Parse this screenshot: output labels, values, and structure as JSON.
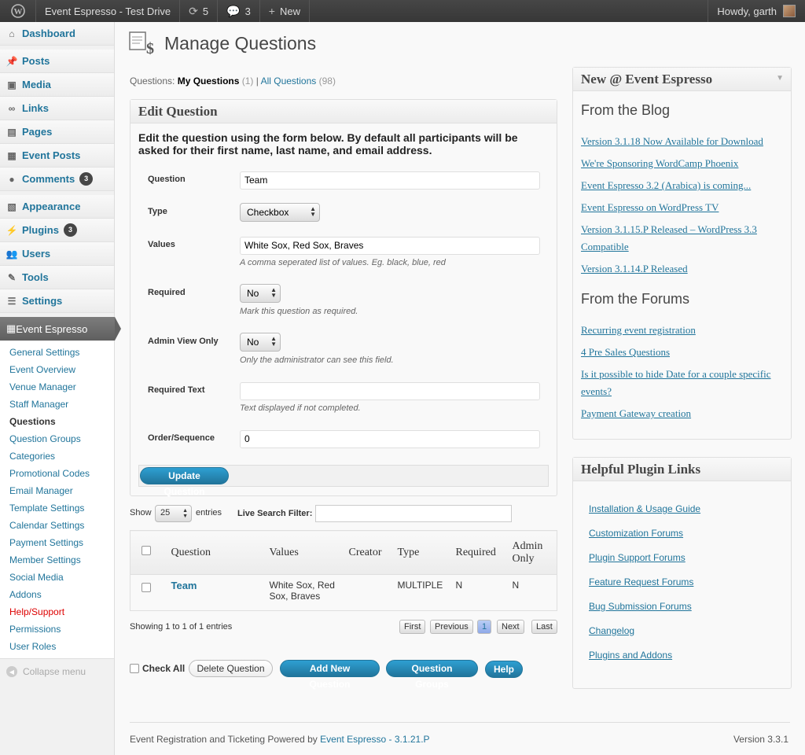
{
  "adminbar": {
    "site_name": "Event Espresso - Test Drive",
    "updates_count": "5",
    "comments_count": "3",
    "new_label": "New",
    "howdy": "Howdy, garth"
  },
  "sidebar": {
    "dashboard": "Dashboard",
    "posts": "Posts",
    "media": "Media",
    "links": "Links",
    "pages": "Pages",
    "event_posts": "Event Posts",
    "comments": "Comments",
    "comments_count": "3",
    "appearance": "Appearance",
    "plugins": "Plugins",
    "plugins_count": "3",
    "users": "Users",
    "tools": "Tools",
    "settings": "Settings",
    "event_espresso": "Event Espresso",
    "submenu": [
      "General Settings",
      "Event Overview",
      "Venue Manager",
      "Staff Manager",
      "Questions",
      "Question Groups",
      "Categories",
      "Promotional Codes",
      "Email Manager",
      "Template Settings",
      "Calendar Settings",
      "Payment Settings",
      "Member Settings",
      "Social Media",
      "Addons",
      "Help/Support",
      "Permissions",
      "User Roles"
    ],
    "collapse": "Collapse menu"
  },
  "page": {
    "title": "Manage Questions",
    "filter_label": "Questions:",
    "my_questions": "My Questions",
    "my_count": "(1)",
    "separator": "|",
    "all_questions": "All Questions",
    "all_count": "(98)"
  },
  "edit": {
    "box_title": "Edit Question",
    "intro": "Edit the question using the form below. By default all participants will be asked for their first name, last name, and email address.",
    "question_label": "Question",
    "question_value": "Team",
    "type_label": "Type",
    "type_value": "Checkbox",
    "values_label": "Values",
    "values_value": "White Sox, Red Sox, Braves",
    "values_hint": "A comma seperated list of values. Eg. black, blue, red",
    "required_label": "Required",
    "required_value": "No",
    "required_hint": "Mark this question as required.",
    "admin_label": "Admin View Only",
    "admin_value": "No",
    "admin_hint": "Only the administrator can see this field.",
    "reqtext_label": "Required Text",
    "reqtext_value": "",
    "reqtext_hint": "Text displayed if not completed.",
    "order_label": "Order/Sequence",
    "order_value": "0",
    "update_button": "Update Question"
  },
  "table": {
    "show": "Show",
    "length": "25",
    "entries": "entries",
    "search_label": "Live Search Filter:",
    "columns": [
      "Question",
      "Values",
      "Creator",
      "Type",
      "Required",
      "Admin Only"
    ],
    "rows": [
      {
        "question": "Team",
        "values": "White Sox, Red Sox, Braves",
        "creator": "",
        "type": "MULTIPLE",
        "required": "N",
        "admin_only": "N"
      }
    ],
    "info": "Showing 1 to 1 of 1 entries",
    "first": "First",
    "previous": "Previous",
    "page": "1",
    "next": "Next",
    "last": "Last"
  },
  "actions": {
    "check_all": "Check All",
    "delete": "Delete Question",
    "add_new": "Add New Question",
    "groups": "Question Groups",
    "help": "Help"
  },
  "news": {
    "box_title": "New @ Event Espresso",
    "blog_heading": "From the Blog",
    "blog_links": [
      "Version 3.1.18 Now Available for Download",
      "We're Sponsoring WordCamp Phoenix",
      "Event Espresso 3.2 (Arabica) is coming...",
      "Event Espresso on WordPress TV",
      "Version 3.1.15.P Released – WordPress 3.3 Compatible",
      "Version 3.1.14.P Released"
    ],
    "forums_heading": "From the Forums",
    "forum_links": [
      "Recurring event registration",
      "4 Pre Sales Questions",
      "Is it possible to hide Date for a couple specific events?",
      "Payment Gateway creation"
    ]
  },
  "helpful": {
    "box_title": "Helpful Plugin Links",
    "links": [
      "Installation & Usage Guide",
      "Customization Forums",
      "Plugin Support Forums",
      "Feature Request Forums",
      "Bug Submission Forums",
      "Changelog",
      "Plugins and Addons"
    ]
  },
  "footer": {
    "left_text": "Event Registration and Ticketing Powered by",
    "left_link": "Event Espresso - 3.1.21.P",
    "version": "Version 3.3.1"
  },
  "colors": {
    "link": "#21759b",
    "primary_button": "#21759b",
    "help_support": "#dd0000"
  }
}
